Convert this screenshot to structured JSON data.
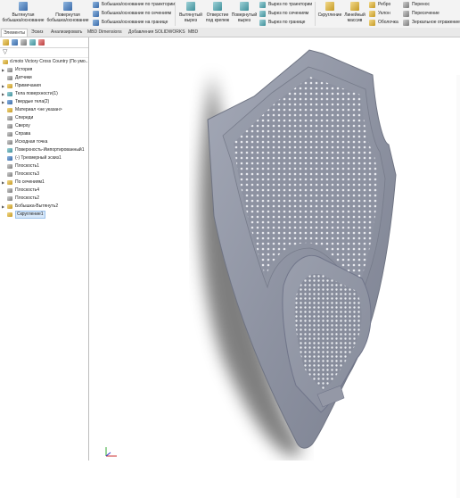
{
  "ribbon": {
    "extrude_boss": {
      "line1": "Вытянутая",
      "line2": "бобышка/основание"
    },
    "revolve_boss": {
      "line1": "Повернутая",
      "line2": "бобышка/основание"
    },
    "sweep_boss": "Бобышка/основание по траектории",
    "loft_boss": "Бобышка/основание по сечениям",
    "boundary_boss": "Бобышка/основание на границе",
    "extrude_cut": {
      "line1": "Вытянутый",
      "line2": "вырез"
    },
    "hole_wizard": {
      "line1": "Отверстие",
      "line2": "под крепеж"
    },
    "revolve_cut": {
      "line1": "Повернутый",
      "line2": "вырез"
    },
    "sweep_cut": "Вырез по траектории",
    "loft_cut": "Вырез по сечениям",
    "boundary_cut": "Вырез по границе",
    "fillet": "Скругление",
    "linear_pattern": {
      "line1": "Линейный",
      "line2": "массив"
    },
    "rib": "Ребро",
    "draft": "Уклон",
    "shell": "Оболочка",
    "wrap": "Перенос",
    "intersect": "Пересечение",
    "mirror": "Зеркальное отражение"
  },
  "tabs": [
    "Элементы",
    "Эскиз",
    "Анализировать",
    "MBD Dimensions",
    "Добавления SOLIDWORKS",
    "MBD"
  ],
  "tree": {
    "root": "d.moto  Victory Cross Country  (По умо...",
    "items": [
      {
        "label": "История",
        "expandable": true
      },
      {
        "label": "Датчики",
        "expandable": false
      },
      {
        "label": "Примечания",
        "expandable": true
      },
      {
        "label": "Тела поверхности(1)",
        "expandable": true
      },
      {
        "label": "Твердые тела(2)",
        "expandable": true
      },
      {
        "label": "Материал <не указан>",
        "expandable": false
      },
      {
        "label": "Спереди",
        "expandable": false
      },
      {
        "label": "Сверху",
        "expandable": false
      },
      {
        "label": "Справа",
        "expandable": false
      },
      {
        "label": "Исходная точка",
        "expandable": false
      },
      {
        "label": "Поверхность-Импортированный1",
        "expandable": false
      },
      {
        "label": "(-) Трехмерный эскиз1",
        "expandable": false
      },
      {
        "label": "Плоскость1",
        "expandable": false
      },
      {
        "label": "Плоскость3",
        "expandable": false
      },
      {
        "label": "По сечениям1",
        "expandable": true
      },
      {
        "label": "Плоскость4",
        "expandable": false
      },
      {
        "label": "Плоскость2",
        "expandable": false
      },
      {
        "label": "Бобышка-Вытянуть2",
        "expandable": true
      },
      {
        "label": "Скругление1",
        "expandable": false
      }
    ]
  },
  "colors": {
    "accent": "#3a6aa8",
    "model": "#8e93a1",
    "selection": "#d7e8fa"
  }
}
